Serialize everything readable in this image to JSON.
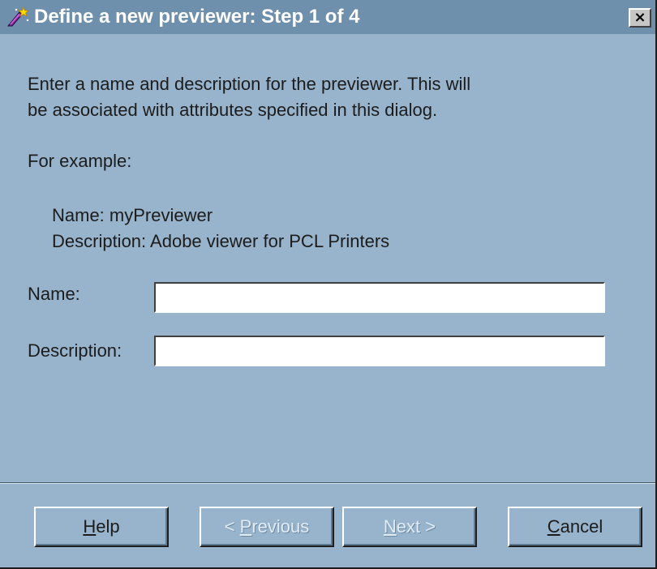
{
  "window": {
    "title": "Define a new previewer: Step 1 of 4",
    "close_glyph": "×"
  },
  "icons": {
    "app_icon": "wizard-wand-icon",
    "close_icon": "close-icon"
  },
  "content": {
    "instruction_line1": "Enter a name and description for the previewer.  This will",
    "instruction_line2": "be associated with attributes specified in this dialog.",
    "example_heading": "For example:",
    "example_name": "Name: myPreviewer",
    "example_description": "Description: Adobe viewer for PCL Printers"
  },
  "form": {
    "name_label": "Name:",
    "name_value": "",
    "description_label": "Description:",
    "description_value": ""
  },
  "buttons": {
    "help": {
      "mnemonic": "H",
      "rest": "elp",
      "enabled": true
    },
    "previous": {
      "prefix": "< ",
      "mnemonic": "P",
      "rest": "revious",
      "enabled": false
    },
    "next": {
      "mnemonic": "N",
      "rest": "ext >",
      "enabled": false
    },
    "cancel": {
      "mnemonic": "C",
      "rest": "ancel",
      "enabled": true
    }
  },
  "colors": {
    "dialog_background": "#98b4cc",
    "titlebar": "#6f90ac",
    "title_text": "#ffffff",
    "disabled_text": "#e2ecf4"
  }
}
